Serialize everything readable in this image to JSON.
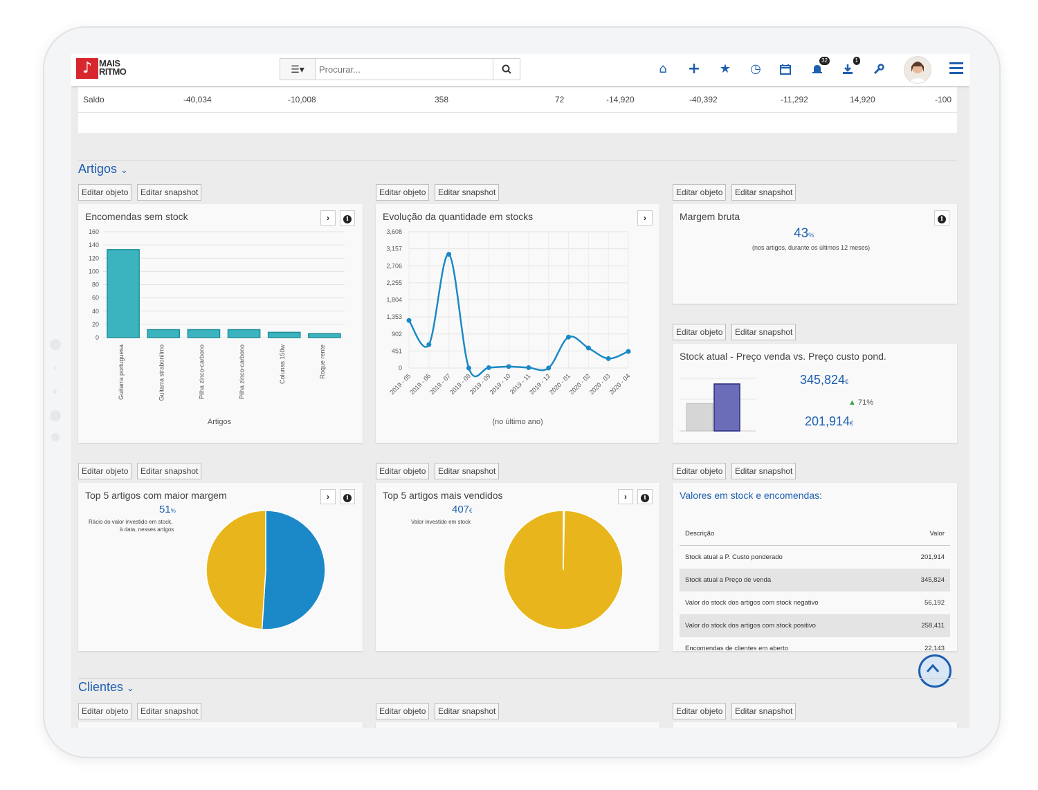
{
  "app": {
    "logo_line1": "MAIS",
    "logo_line2": "RITMO"
  },
  "search": {
    "placeholder": "Procurar..."
  },
  "nav": {
    "messages_badge": "32",
    "downloads_badge": "1"
  },
  "saldo_row": {
    "label": "Saldo",
    "values": [
      "-40,034",
      "-10,008",
      "358",
      "72",
      "-14,920",
      "-40,392",
      "-11,292",
      "14,920",
      "-100"
    ]
  },
  "sections": {
    "artigos": "Artigos",
    "clientes": "Clientes"
  },
  "buttons": {
    "edit_object": "Editar objeto",
    "edit_snapshot": "Editar snapshot"
  },
  "widgets": {
    "encomendas": {
      "title": "Encomendas sem stock"
    },
    "evolucao": {
      "title": "Evolução da quantidade em stocks"
    },
    "margem": {
      "title": "Margem bruta",
      "value": "43",
      "unit": "%",
      "note": "(nos artigos, durante os últimos 12 meses)"
    },
    "stock_atual": {
      "title": "Stock atual - Preço venda vs. Preço custo pond.",
      "value_top": "345,824",
      "value_bottom": "201,914",
      "unit": "€",
      "change": "71%",
      "change_color": "#3aa44a"
    },
    "top_margem": {
      "title": "Top 5 artigos com maior margem",
      "value": "51",
      "unit": "%",
      "note1": "Rácio do valor investido em stock,",
      "note2": "à data, nesses artigos"
    },
    "top_vendidos": {
      "title": "Top 5 artigos mais vendidos",
      "value": "407",
      "unit": "€",
      "note": "Valor investido em stock"
    },
    "valores": {
      "title": "Valores em stock e encomendas:",
      "headers": [
        "Descrição",
        "Valor"
      ],
      "rows": [
        [
          "Stock atual a P. Custo ponderado",
          "201,914"
        ],
        [
          "Stock atual a Preço de venda",
          "345,824"
        ],
        [
          "Valor do stock dos artigos com stock negativo",
          "56,192"
        ],
        [
          "Valor do stock dos artigos com stock positivo",
          "258,411"
        ],
        [
          "Encomendas de clientes em aberto",
          "22,143"
        ]
      ]
    }
  },
  "colors": {
    "accent": "#1d5fb0",
    "bar_teal": "#3bb4bf",
    "line_blue": "#1a8ac6",
    "pie_yellow": "#e8b61c",
    "pie_blue": "#1b88c8",
    "bar_grey": "#d6d6d6",
    "bar_purple": "#6b6db8"
  },
  "icons": [
    "list-icon",
    "search-icon",
    "home-icon",
    "plus-icon",
    "star-icon",
    "clock-icon",
    "calendar-icon",
    "bell-icon",
    "download-icon",
    "wrench-icon",
    "menu-icon",
    "chevron-down-icon",
    "chevron-right-icon",
    "info-icon",
    "chevron-up-icon"
  ],
  "chart_data": [
    {
      "type": "bar",
      "title": "Encomendas sem stock",
      "xlabel": "Artigos",
      "ylabel": "",
      "categories": [
        "Guitarra portuguesa",
        "Guitarra strabonilmo",
        "Pilha zinco-carbono",
        "Pilha zinco-carbono",
        "Colunas 150w",
        "Roque rente"
      ],
      "values": [
        133,
        12,
        12,
        12,
        8,
        6
      ],
      "ylim": [
        0,
        160
      ],
      "yticks": [
        "160",
        "140",
        "120",
        "100",
        "80",
        "60",
        "40",
        "20",
        "0"
      ],
      "grid": true
    },
    {
      "type": "line",
      "title": "Evolução da quantidade em stocks",
      "xlabel": "(no último ano)",
      "ylabel": "",
      "x": [
        "2019 - 05",
        "2019 - 06",
        "2019 - 07",
        "2019 - 08",
        "2019 - 09",
        "2019 - 10",
        "2019 - 11",
        "2019 - 12",
        "2020 - 01",
        "2020 - 02",
        "2020 - 03",
        "2020 - 04"
      ],
      "values": [
        1260,
        620,
        3010,
        0,
        10,
        40,
        10,
        0,
        820,
        530,
        250,
        440
      ],
      "ylim": [
        0,
        3608
      ],
      "yticks": [
        "3,608",
        "3,157",
        "2,706",
        "2,255",
        "1,804",
        "1,353",
        "902",
        "451",
        "0"
      ],
      "grid": true
    },
    {
      "type": "bar",
      "title": "Stock atual - Preço venda vs. Preço custo pond.",
      "categories": [
        "",
        ""
      ],
      "values": [
        201914,
        345824
      ]
    },
    {
      "type": "pie",
      "title": "Top 5 artigos com maior margem",
      "values": [
        49,
        51
      ]
    },
    {
      "type": "pie",
      "title": "Top 5 artigos mais vendidos",
      "values": [
        99.7,
        0.3
      ]
    }
  ]
}
